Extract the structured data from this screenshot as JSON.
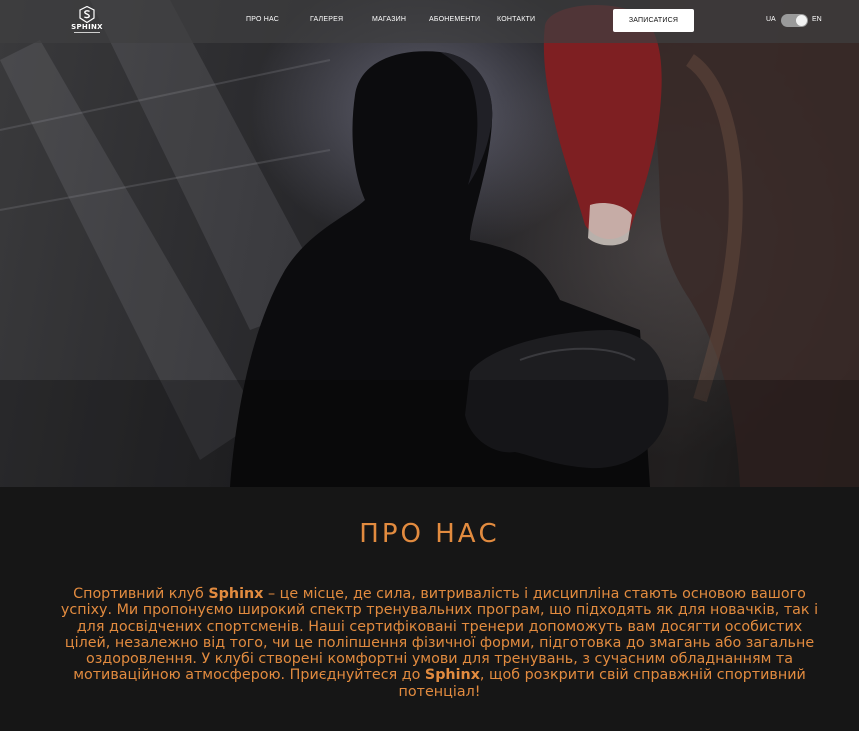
{
  "brand": {
    "name": "SPHINX",
    "logo_icon": "sphinx-logo-icon"
  },
  "nav": {
    "links": [
      "ПРО НАС",
      "ГАЛЕРЕЯ",
      "МАГАЗИН",
      "АБОНЕМЕНТИ",
      "КОНТАКТИ"
    ],
    "cta_label": "ЗАПИСАТИСЯ",
    "lang_left": "UA",
    "lang_right": "EN",
    "lang_toggle_state": "EN"
  },
  "about": {
    "title": "ПРО НАС",
    "text": {
      "part1": "Спортивний клуб ",
      "brand1": "Sphinx",
      "part2": " – це місце, де сила, витривалість і дисципліна стають основою вашого успіху. Ми пропонуємо широкий спектр тренувальних програм, що підходять як для новачків, так і для досвідчених спортсменів. Наші сертифіковані тренери допоможуть вам досягти особистих цілей, незалежно від того, чи це поліпшення фізичної форми, підготовка до змагань або загальне оздоровлення. У клубі створені комфортні умови для тренувань, з сучасним обладнанням та мотиваційною атмосферою. Приєднуйтеся до ",
      "brand2": "Sphinx",
      "part3": ", щоб розкрити свій справжній спортивний потенціал!"
    }
  },
  "colors": {
    "accent": "#e28b3f",
    "background": "#161616",
    "nav_background": "#3e3e40"
  }
}
